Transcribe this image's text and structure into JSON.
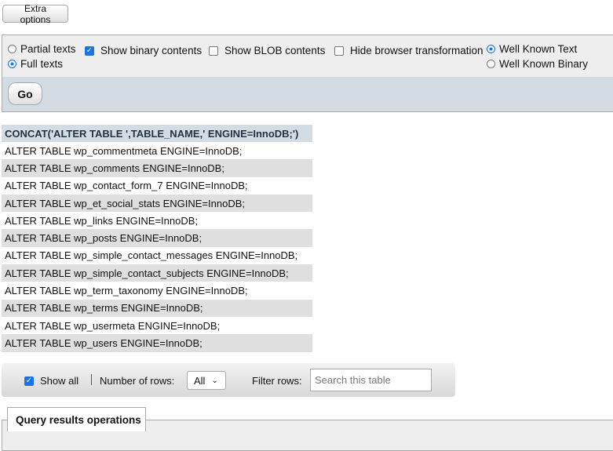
{
  "top": {
    "extra_options_label": "Extra options"
  },
  "options": {
    "partial_texts": "Partial texts",
    "full_texts": "Full texts",
    "show_binary": "Show binary contents",
    "show_blob": "Show BLOB contents",
    "hide_transformation": "Hide browser transformation",
    "well_known_text": "Well Known Text",
    "well_known_binary": "Well Known Binary",
    "go_label": "Go"
  },
  "results": {
    "column_header": "CONCAT('ALTER TABLE ',TABLE_NAME,' ENGINE=InnoDB;')",
    "rows": [
      "ALTER TABLE wp_commentmeta ENGINE=InnoDB;",
      "ALTER TABLE wp_comments ENGINE=InnoDB;",
      "ALTER TABLE wp_contact_form_7 ENGINE=InnoDB;",
      "ALTER TABLE wp_et_social_stats ENGINE=InnoDB;",
      "ALTER TABLE wp_links ENGINE=InnoDB;",
      "ALTER TABLE wp_posts ENGINE=InnoDB;",
      "ALTER TABLE wp_simple_contact_messages ENGINE=InnoDB;",
      "ALTER TABLE wp_simple_contact_subjects ENGINE=InnoDB;",
      "ALTER TABLE wp_term_taxonomy ENGINE=InnoDB;",
      "ALTER TABLE wp_terms ENGINE=InnoDB;",
      "ALTER TABLE wp_usermeta ENGINE=InnoDB;",
      "ALTER TABLE wp_users ENGINE=InnoDB;"
    ]
  },
  "navigation": {
    "show_all": "Show all",
    "number_of_rows_label": "Number of rows:",
    "rows_selected": "All",
    "filter_rows_label": "Filter rows:",
    "search_placeholder": "Search this table"
  },
  "query_ops": {
    "tab_label": "Query results operations"
  }
}
